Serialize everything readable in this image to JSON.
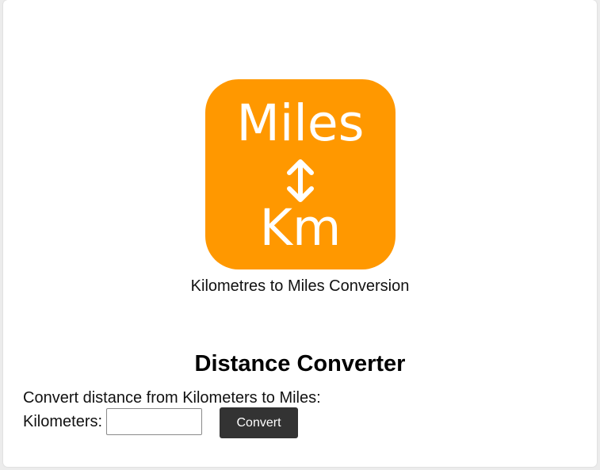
{
  "logo": {
    "top_word": "Miles",
    "bottom_word": "Km",
    "arrow_icon": "up-down-arrow-icon",
    "color": "#ff9800"
  },
  "caption": "Kilometres to Miles Conversion",
  "converter": {
    "title": "Distance Converter",
    "description": "Convert distance from Kilometers to Miles:",
    "input_label": "Kilometers:",
    "input_value": "",
    "button_label": "Convert",
    "button_color": "#333333"
  }
}
